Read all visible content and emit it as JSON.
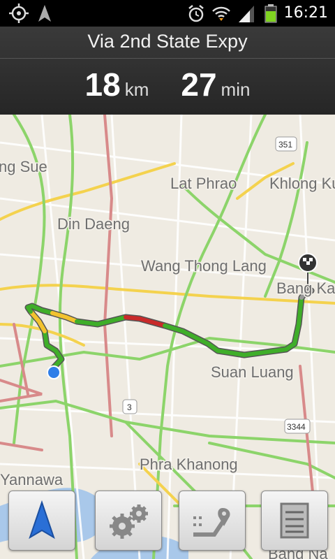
{
  "status_bar": {
    "time": "16:21"
  },
  "route": {
    "via": "Via 2nd State Expy",
    "distance_value": "18",
    "distance_unit": "km",
    "duration_value": "27",
    "duration_unit": "min"
  },
  "map": {
    "labels": {
      "l1": "ng Sue",
      "l2": "Lat Phrao",
      "l3": "Khlong Ku",
      "l4": "Din Daeng",
      "l5": "Wang Thong Lang",
      "l6": "Bang Kap",
      "l7": "Suan Luang",
      "l8": "Phra Khanong",
      "l9": "Yannawa",
      "l10": "Bang Na"
    },
    "shields": {
      "s1": "351",
      "s2": "3",
      "s3": "3344"
    }
  },
  "toolbar": {
    "buttons": [
      {
        "icon": "navigation-arrow-icon"
      },
      {
        "icon": "settings-gears-icon"
      },
      {
        "icon": "route-directions-icon"
      },
      {
        "icon": "list-icon"
      }
    ]
  }
}
